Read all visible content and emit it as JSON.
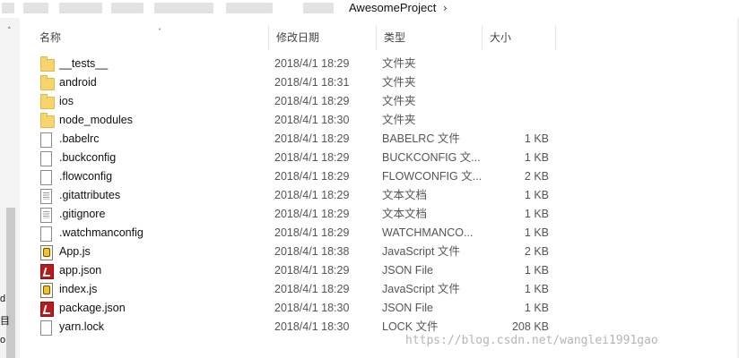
{
  "breadcrumb": {
    "current": "AwesomeProject",
    "separator_icon": "chevron-right-icon",
    "separator": "›"
  },
  "nav_pane": {
    "scroll_up": "˄",
    "fragments": [
      "d",
      "目",
      "o"
    ]
  },
  "columns": {
    "name": "名称",
    "date": "修改日期",
    "type": "类型",
    "size": "大小",
    "sort_indicator": "˄"
  },
  "files": [
    {
      "name": "__tests__",
      "date": "2018/4/1 18:29",
      "type": "文件夹",
      "size": "",
      "icon": "folder-icon"
    },
    {
      "name": "android",
      "date": "2018/4/1 18:31",
      "type": "文件夹",
      "size": "",
      "icon": "folder-icon"
    },
    {
      "name": "ios",
      "date": "2018/4/1 18:29",
      "type": "文件夹",
      "size": "",
      "icon": "folder-icon"
    },
    {
      "name": "node_modules",
      "date": "2018/4/1 18:30",
      "type": "文件夹",
      "size": "",
      "icon": "folder-icon"
    },
    {
      "name": ".babelrc",
      "date": "2018/4/1 18:29",
      "type": "BABELRC 文件",
      "size": "1 KB",
      "icon": "file-icon"
    },
    {
      "name": ".buckconfig",
      "date": "2018/4/1 18:29",
      "type": "BUCKCONFIG 文...",
      "size": "1 KB",
      "icon": "file-icon"
    },
    {
      "name": ".flowconfig",
      "date": "2018/4/1 18:29",
      "type": "FLOWCONFIG 文...",
      "size": "2 KB",
      "icon": "file-icon"
    },
    {
      "name": ".gitattributes",
      "date": "2018/4/1 18:29",
      "type": "文本文档",
      "size": "1 KB",
      "icon": "text-file-icon"
    },
    {
      "name": ".gitignore",
      "date": "2018/4/1 18:29",
      "type": "文本文档",
      "size": "1 KB",
      "icon": "text-file-icon"
    },
    {
      "name": ".watchmanconfig",
      "date": "2018/4/1 18:29",
      "type": "WATCHMANCO...",
      "size": "1 KB",
      "icon": "file-icon"
    },
    {
      "name": "App.js",
      "date": "2018/4/1 18:38",
      "type": "JavaScript 文件",
      "size": "2 KB",
      "icon": "javascript-file-icon"
    },
    {
      "name": "app.json",
      "date": "2018/4/1 18:29",
      "type": "JSON File",
      "size": "1 KB",
      "icon": "json-file-icon"
    },
    {
      "name": "index.js",
      "date": "2018/4/1 18:29",
      "type": "JavaScript 文件",
      "size": "1 KB",
      "icon": "javascript-file-icon"
    },
    {
      "name": "package.json",
      "date": "2018/4/1 18:30",
      "type": "JSON File",
      "size": "1 KB",
      "icon": "json-file-icon"
    },
    {
      "name": "yarn.lock",
      "date": "2018/4/1 18:30",
      "type": "LOCK 文件",
      "size": "208 KB",
      "icon": "file-icon"
    }
  ],
  "watermark": "https://blog.csdn.net/wanglei1991gao",
  "colors": {
    "folder": "#f7d46c",
    "json_icon": "#b71c1c",
    "js_icon": "#f0c22f"
  }
}
